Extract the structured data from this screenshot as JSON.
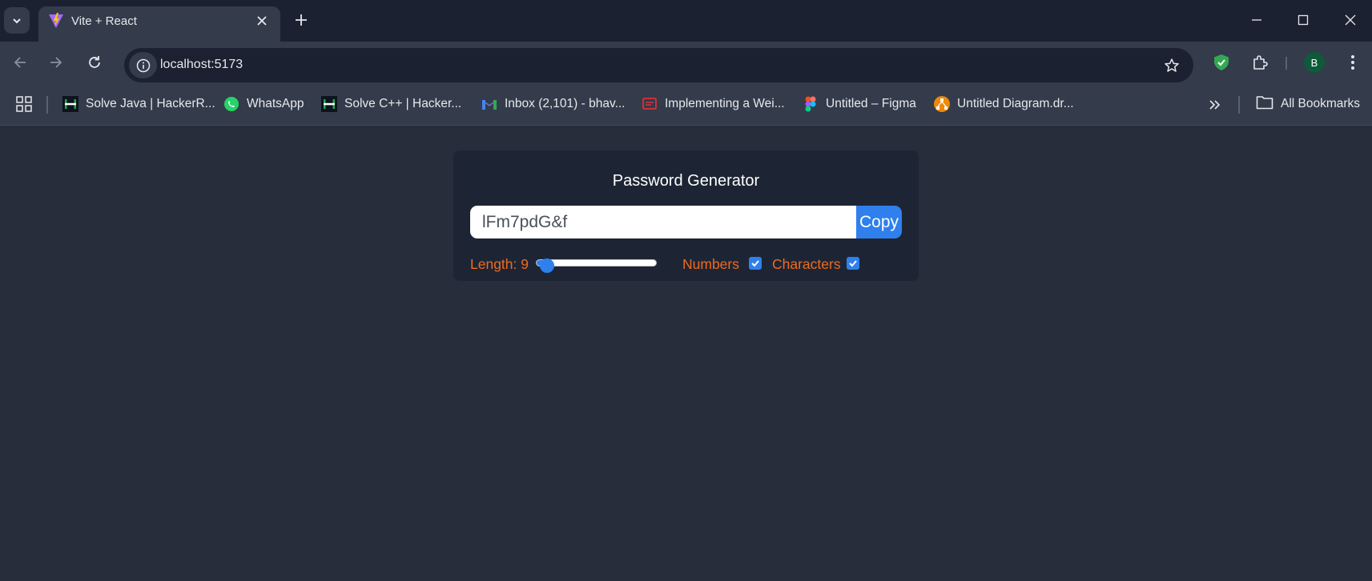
{
  "browser": {
    "tab": {
      "title": "Vite + React"
    },
    "address_bar": {
      "url": "localhost:5173"
    },
    "profile": {
      "initial": "B"
    },
    "bookmarks": [
      {
        "label": "Solve Java | HackerR...",
        "icon": "hackerrank-icon"
      },
      {
        "label": "WhatsApp",
        "icon": "whatsapp-icon"
      },
      {
        "label": "Solve C++ | Hacker...",
        "icon": "hackerrank-icon"
      },
      {
        "label": "Inbox (2,101) - bhav...",
        "icon": "gmail-icon"
      },
      {
        "label": "Implementing a Wei...",
        "icon": "slides-icon"
      },
      {
        "label": "Untitled – Figma",
        "icon": "figma-icon"
      },
      {
        "label": "Untitled Diagram.dr...",
        "icon": "drawio-icon"
      }
    ],
    "all_bookmarks_label": "All Bookmarks"
  },
  "app": {
    "title": "Password Generator",
    "password": "lFm7pdG&f",
    "copy_label": "Copy",
    "length_label": "Length: 9",
    "length": {
      "value": 9,
      "min": 6,
      "max": 100
    },
    "numbers_label": "Numbers",
    "numbers_checked": true,
    "characters_label": "Characters",
    "characters_checked": true
  },
  "colors": {
    "page_bg": "#272d3b",
    "card_bg": "#1d2534",
    "accent": "#2f80ed",
    "label_orange": "#f06a1e"
  }
}
